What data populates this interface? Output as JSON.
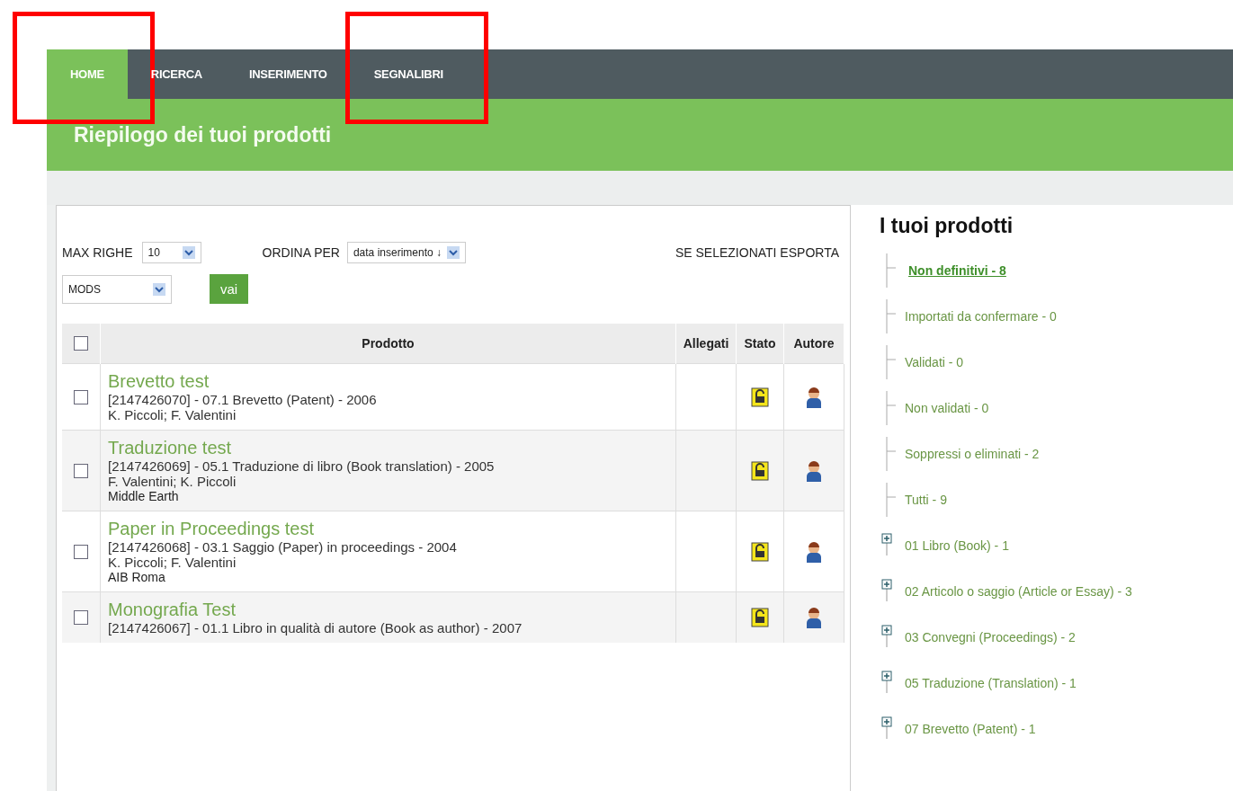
{
  "nav": {
    "tabs": [
      {
        "label": "HOME",
        "selected": true,
        "highlighted": true
      },
      {
        "label": "RICERCA",
        "selected": false,
        "highlighted": false
      },
      {
        "label": "INSERIMENTO",
        "selected": false,
        "highlighted": false
      },
      {
        "label": "SEGNALIBRI",
        "selected": false,
        "highlighted": true
      }
    ]
  },
  "page_title": "Riepilogo dei tuoi prodotti",
  "controls": {
    "max_rows_label": "MAX RIGHE",
    "max_rows_value": "10",
    "sort_label": "ORDINA PER",
    "sort_value": "data inserimento ↓",
    "export_label": "SE SELEZIONATI ESPORTA",
    "format_value": "MODS",
    "go_button": "vai"
  },
  "table": {
    "select_all_checked": false,
    "columns": [
      "Prodotto",
      "Allegati",
      "Stato",
      "Autore"
    ],
    "rows": [
      {
        "checked": false,
        "title": "Brevetto test",
        "reference": "[2147426070] - 07.1 Brevetto (Patent) - 2006",
        "authors": "K. Piccoli; F. Valentini"
      },
      {
        "checked": false,
        "title": "Traduzione test",
        "reference": "[2147426069] - 05.1 Traduzione di libro (Book translation) - 2005",
        "authors": "F. Valentini; K. Piccoli",
        "extra": "Middle Earth"
      },
      {
        "checked": false,
        "title": "Paper in Proceedings test",
        "reference": "[2147426068] - 03.1 Saggio (Paper) in proceedings - 2004",
        "authors": "K. Piccoli; F. Valentini",
        "extra": "AIB Roma"
      },
      {
        "checked": false,
        "title": "Monografia Test",
        "reference": "[2147426067] - 01.1 Libro in qualità di autore (Book as author) - 2007"
      }
    ]
  },
  "sidebar": {
    "title": "I tuoi prodotti",
    "items": [
      {
        "kind": "leaf",
        "label": "Non definitivi - 8",
        "selected": true
      },
      {
        "kind": "leaf",
        "label": "Importati da confermare - 0",
        "selected": false
      },
      {
        "kind": "leaf",
        "label": "Validati - 0",
        "selected": false
      },
      {
        "kind": "leaf",
        "label": "Non validati - 0",
        "selected": false
      },
      {
        "kind": "leaf",
        "label": "Soppressi o eliminati - 2",
        "selected": false
      },
      {
        "kind": "leaf",
        "label": "Tutti - 9",
        "selected": false
      },
      {
        "kind": "group",
        "label": "01 Libro (Book) - 1",
        "selected": false,
        "expanded": false
      },
      {
        "kind": "group",
        "label": "02 Articolo o saggio (Article or Essay) - 3",
        "selected": false,
        "expanded": false
      },
      {
        "kind": "group",
        "label": "03 Convegni (Proceedings) - 2",
        "selected": false,
        "expanded": false
      },
      {
        "kind": "group",
        "label": "05 Traduzione (Translation) - 1",
        "selected": false,
        "expanded": false
      },
      {
        "kind": "group",
        "label": "07 Brevetto (Patent) - 1",
        "selected": false,
        "expanded": false
      }
    ]
  }
}
